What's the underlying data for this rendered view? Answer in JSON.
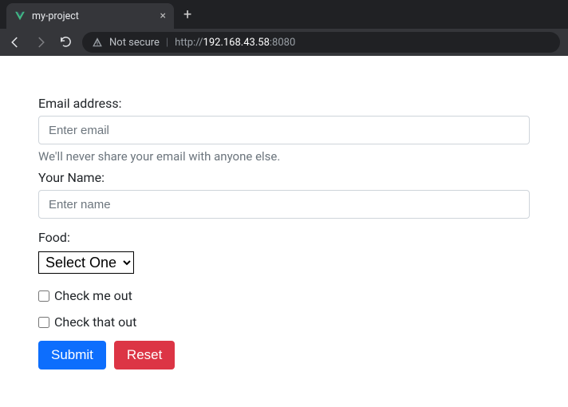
{
  "browser": {
    "tab_title": "my-project",
    "not_secure_label": "Not secure",
    "url_proto": "http://",
    "url_host": "192.168.43.58",
    "url_port": ":8080"
  },
  "form": {
    "email": {
      "label": "Email address:",
      "placeholder": "Enter email",
      "help": "We'll never share your email with anyone else."
    },
    "name": {
      "label": "Your Name:",
      "placeholder": "Enter name"
    },
    "food": {
      "label": "Food:",
      "selected": "Select One"
    },
    "checks": [
      {
        "label": "Check me out"
      },
      {
        "label": "Check that out"
      }
    ],
    "buttons": {
      "submit": "Submit",
      "reset": "Reset"
    }
  }
}
